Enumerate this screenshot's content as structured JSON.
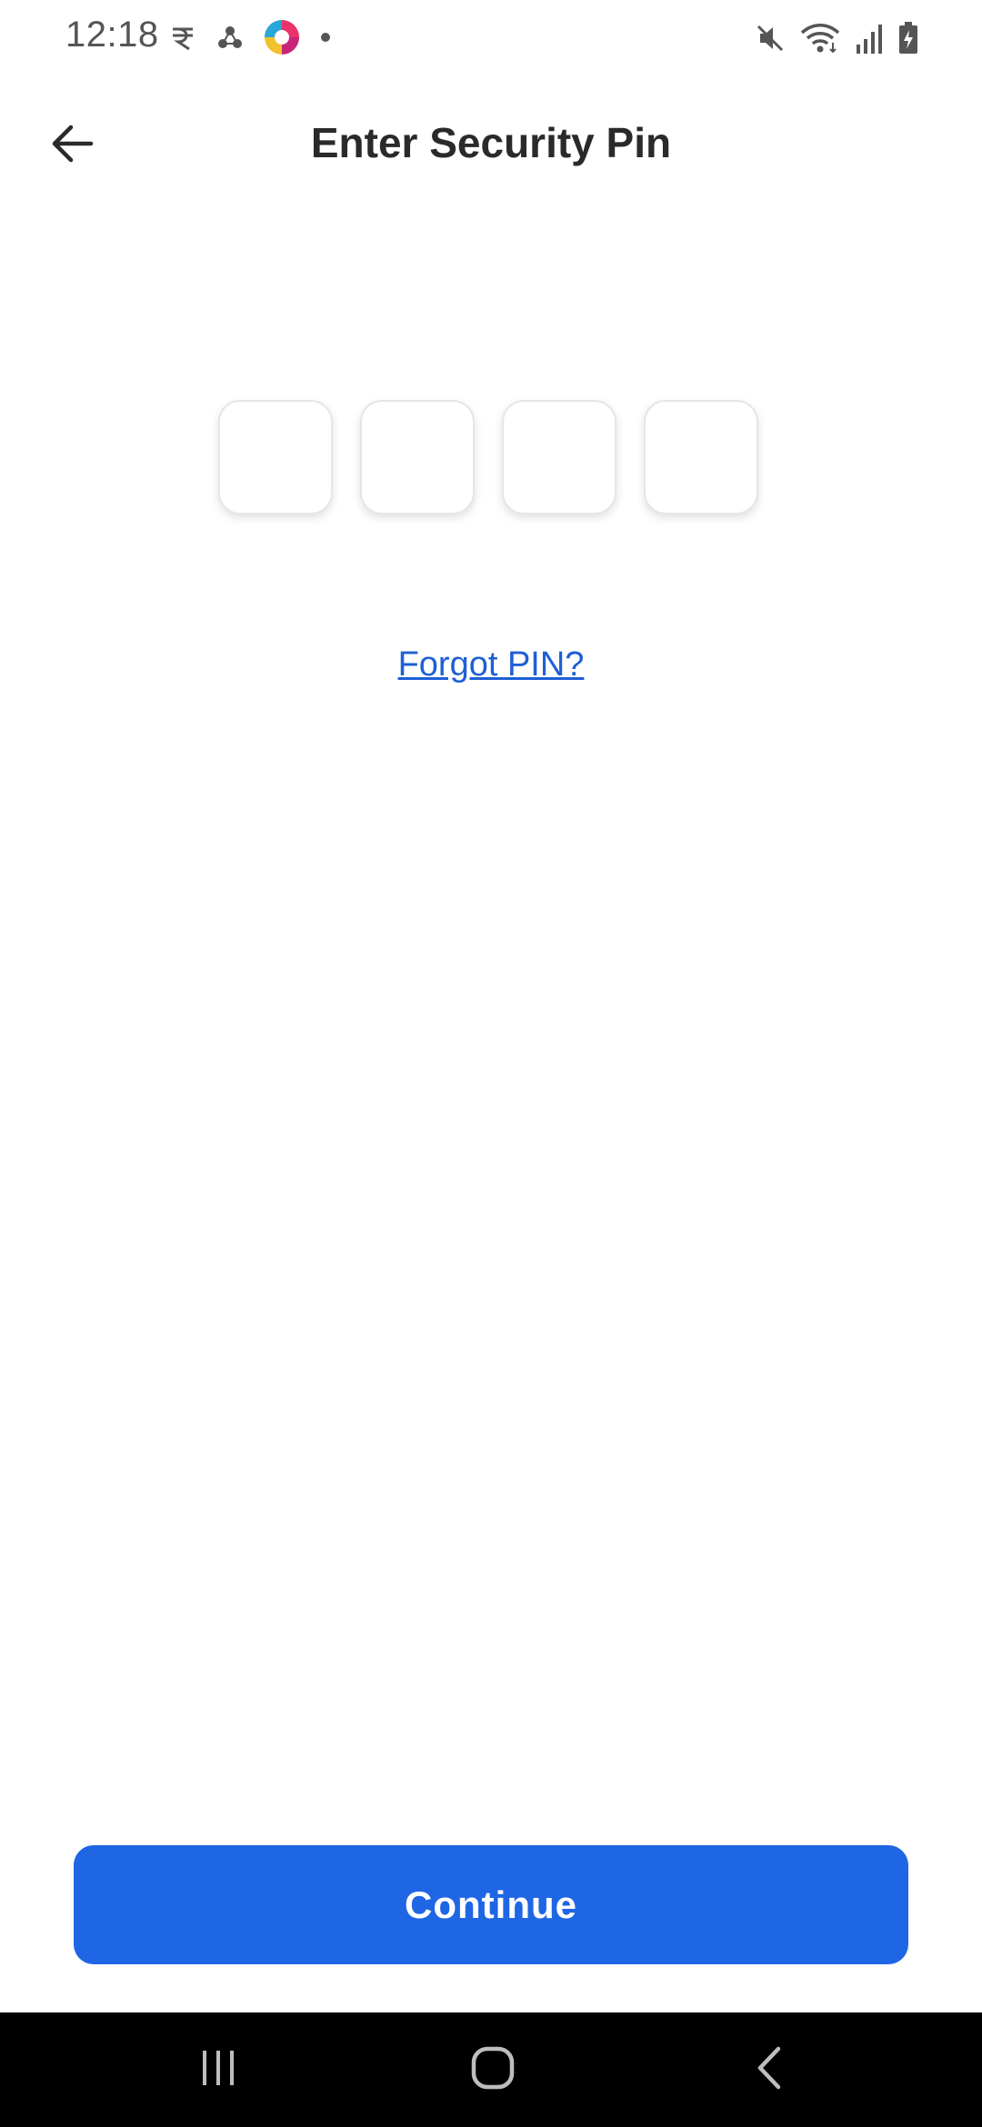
{
  "status_bar": {
    "time": "12:18",
    "left_icons": [
      "rupee-icon",
      "nodes-icon",
      "colorful-app-icon",
      "dot-icon"
    ],
    "right_icons": [
      "mute-icon",
      "wifi-icon",
      "signal-icon",
      "battery-icon"
    ]
  },
  "header": {
    "back_icon": "arrow-left-icon",
    "title": "Enter Security Pin"
  },
  "pin": {
    "length": 4,
    "values": [
      "",
      "",
      "",
      ""
    ]
  },
  "forgot_pin": {
    "label": "Forgot PIN?"
  },
  "continue_button": {
    "label": "Continue"
  },
  "colors": {
    "accent": "#1f66e5",
    "link": "#1f5fd6",
    "title": "#2a2a2a"
  },
  "nav_bar": {
    "buttons": [
      "recent-apps-icon",
      "home-icon",
      "back-nav-icon"
    ]
  }
}
